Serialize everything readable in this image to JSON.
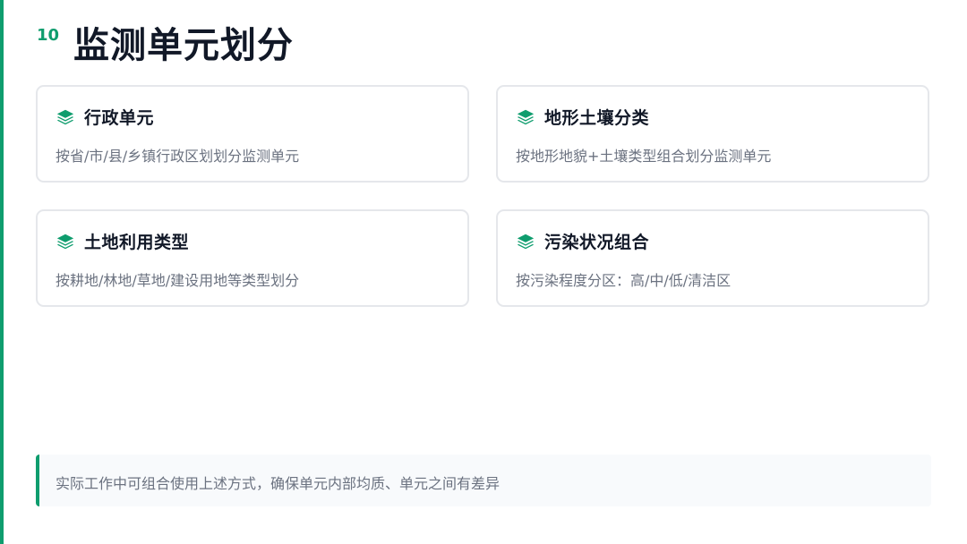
{
  "slide": {
    "page_number": "10",
    "title": "监测单元划分"
  },
  "cards": [
    {
      "title": "行政单元",
      "description": "按省/市/县/乡镇行政区划划分监测单元",
      "icon": "layers-icon"
    },
    {
      "title": "地形土壤分类",
      "description": "按地形地貌+土壤类型组合划分监测单元",
      "icon": "layers-icon"
    },
    {
      "title": "土地利用类型",
      "description": "按耕地/林地/草地/建设用地等类型划分",
      "icon": "layers-icon"
    },
    {
      "title": "污染状况组合",
      "description": "按污染程度分区：高/中/低/清洁区",
      "icon": "layers-icon"
    }
  ],
  "note": {
    "text": "实际工作中可组合使用上述方式，确保单元内部均质、单元之间有差异"
  },
  "colors": {
    "accent": "#0f9d6e",
    "title": "#111827",
    "muted_text": "#6b7280",
    "card_border": "#e5e7eb",
    "note_bg": "#f8fafc"
  }
}
